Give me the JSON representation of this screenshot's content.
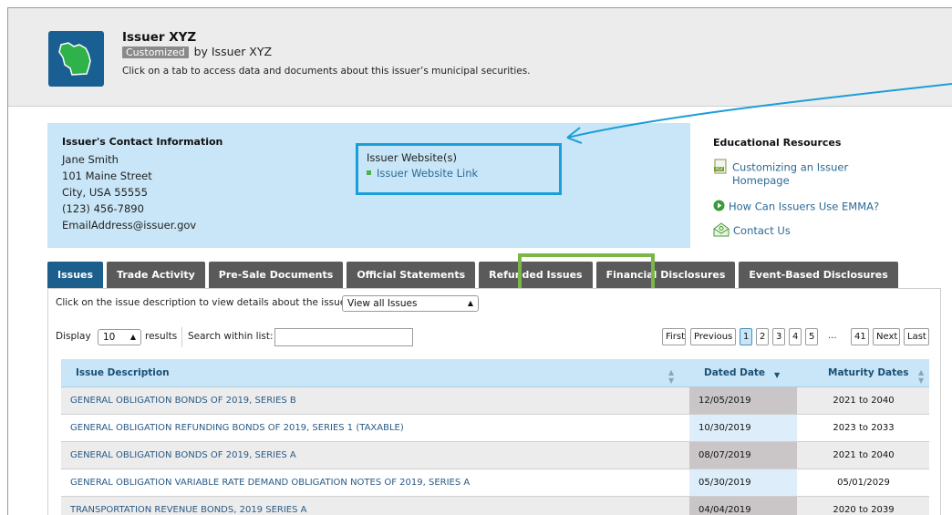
{
  "header": {
    "issuer_name": "Issuer XYZ",
    "customized_badge": "Customized",
    "by_text": "by Issuer XYZ",
    "instructions": "Click on a tab to access data and documents about this issuer’s municipal securities."
  },
  "contact": {
    "title": "Issuer's Contact Information",
    "name": "Jane Smith",
    "street": "101 Maine Street",
    "city": "City, USA 55555",
    "phone": "(123) 456-7890",
    "email": "EmailAddress@issuer.gov",
    "website_title": "Issuer Website(s)",
    "website_link": "Issuer Website Link"
  },
  "education": {
    "title": "Educational Resources",
    "item1_line1": "Customizing an Issuer",
    "item1_line2": "Homepage",
    "item2": "How Can Issuers Use EMMA?",
    "item3": "Contact Us"
  },
  "tabs": [
    {
      "label": "Issues"
    },
    {
      "label": "Trade Activity"
    },
    {
      "label": "Pre-Sale Documents"
    },
    {
      "label": "Official Statements"
    },
    {
      "label": "Refunded Issues"
    },
    {
      "label": "Financial Disclosures"
    },
    {
      "label": "Event-Based Disclosures"
    }
  ],
  "filters": {
    "issue_hint": "Click on the issue description to view details about the issue.",
    "view_select": "View all Issues",
    "display_label": "Display",
    "display_value": "10",
    "results_label": "results",
    "search_label": "Search within list:",
    "search_value": ""
  },
  "pager": {
    "first": "First",
    "previous": "Previous",
    "pages": [
      "1",
      "2",
      "3",
      "4",
      "5"
    ],
    "ellipsis": "...",
    "last_page": "41",
    "next": "Next",
    "last": "Last"
  },
  "table": {
    "col_desc": "Issue Description",
    "col_dated": "Dated Date",
    "col_maturity": "Maturity Dates",
    "rows": [
      {
        "desc": "GENERAL OBLIGATION BONDS OF 2019, SERIES B",
        "dated": "12/05/2019",
        "maturity": "2021 to 2040"
      },
      {
        "desc": "GENERAL OBLIGATION REFUNDING BONDS OF 2019, SERIES 1 (TAXABLE)",
        "dated": "10/30/2019",
        "maturity": "2023 to 2033"
      },
      {
        "desc": "GENERAL OBLIGATION BONDS OF 2019, SERIES A",
        "dated": "08/07/2019",
        "maturity": "2021 to 2040"
      },
      {
        "desc": "GENERAL OBLIGATION VARIABLE RATE DEMAND OBLIGATION NOTES OF 2019, SERIES A",
        "dated": "05/30/2019",
        "maturity": "05/01/2029"
      },
      {
        "desc": "TRANSPORTATION REVENUE BONDS, 2019 SERIES A",
        "dated": "04/04/2019",
        "maturity": "2020 to 2039"
      }
    ]
  },
  "colors": {
    "active_tab": "#1d5f8c",
    "highlight_blue": "#1a9ed9",
    "highlight_green": "#7ab648",
    "panel_blue": "#c8e6f7"
  }
}
